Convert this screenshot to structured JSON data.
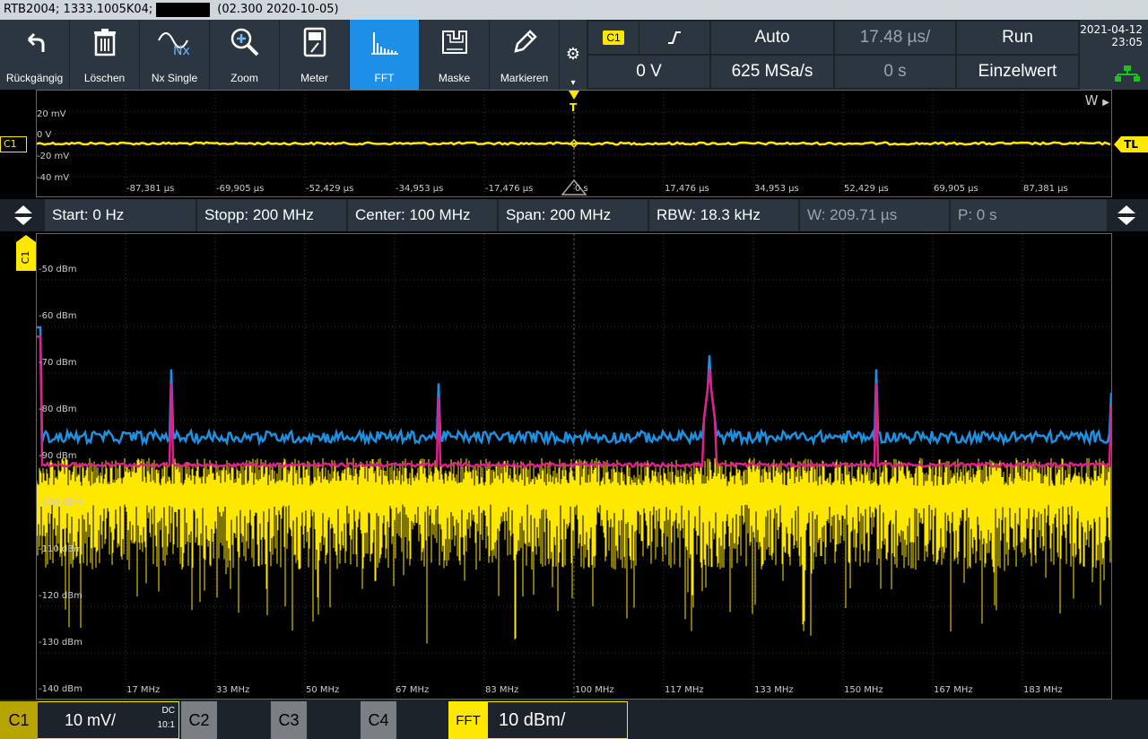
{
  "titlebar": {
    "model": "RTB2004; 1333.1005K04;",
    "firmware": "(02.300 2020-10-05)"
  },
  "toolbar": {
    "buttons": [
      {
        "label": "Rückgängig",
        "icon": "undo-icon"
      },
      {
        "label": "Löschen",
        "icon": "trash-icon"
      },
      {
        "label": "Nx Single",
        "icon": "nx-single-icon",
        "icon_text": "Nx"
      },
      {
        "label": "Zoom",
        "icon": "zoom-icon"
      },
      {
        "label": "Meter",
        "icon": "meter-icon"
      },
      {
        "label": "FFT",
        "icon": "fft-icon",
        "active": true
      },
      {
        "label": "Maske",
        "icon": "mask-icon"
      },
      {
        "label": "Markieren",
        "icon": "pen-icon"
      }
    ]
  },
  "trigger": {
    "source": "C1",
    "slope": "rising-edge",
    "level": "0 V",
    "mode": "Auto",
    "rate": "625 MSa/s"
  },
  "timebase": {
    "scale": "17.48 µs/",
    "position": "0 s"
  },
  "acquisition": {
    "run_state": "Run",
    "single_label": "Einzelwert"
  },
  "datetime": {
    "date": "2021-04-12",
    "time": "23:05"
  },
  "zoom_window": {
    "w_label": "W",
    "y_labels": [
      "20 mV",
      "0 V",
      "-20 mV",
      "-40 mV"
    ],
    "x_labels": [
      "-87,381 µs",
      "-69,905 µs",
      "-52,429 µs",
      "-34,953 µs",
      "-17,476 µs",
      "0 s",
      "17,476 µs",
      "34,953 µs",
      "52,429 µs",
      "69,905 µs",
      "87,381 µs"
    ],
    "channel_tag": "C1",
    "trigger_level_tag": "TL",
    "trigger_marker": "T"
  },
  "status": {
    "start": "Start: 0 Hz",
    "stop": "Stopp: 200 MHz",
    "center": "Center: 100 MHz",
    "span": "Span: 200 MHz",
    "rbw": "RBW: 18.3 kHz",
    "window": "W: 209.71 µs",
    "position": "P: 0 s"
  },
  "fft": {
    "channel": "C1",
    "y_labels": [
      "-50 dBm",
      "-60 dBm",
      "-70 dBm",
      "-80 dBm",
      "-90 dBm",
      "-100 dBm",
      "-110 dBm",
      "-120 dBm",
      "-130 dBm",
      "-140 dBm"
    ],
    "x_labels": [
      "17 MHz",
      "33 MHz",
      "50 MHz",
      "67 MHz",
      "83 MHz",
      "100 MHz",
      "117 MHz",
      "133 MHz",
      "150 MHz",
      "167 MHz",
      "183 MHz"
    ]
  },
  "channels": [
    {
      "name": "C1",
      "scale": "10 mV/",
      "coupling": "DC",
      "probe": "10:1",
      "color": "#ffe800",
      "active": true
    },
    {
      "name": "C2",
      "color": "#888888"
    },
    {
      "name": "C3",
      "color": "#888888"
    },
    {
      "name": "C4",
      "color": "#888888"
    }
  ],
  "fft_scale": {
    "label": "FFT",
    "value": "10 dBm/",
    "color": "#ffe800"
  },
  "colors": {
    "trace": "#ffe800",
    "max_hold": "#1e90e0",
    "average": "#e0208a",
    "toolbar": "#2c3640",
    "active": "#1e8fe6"
  }
}
